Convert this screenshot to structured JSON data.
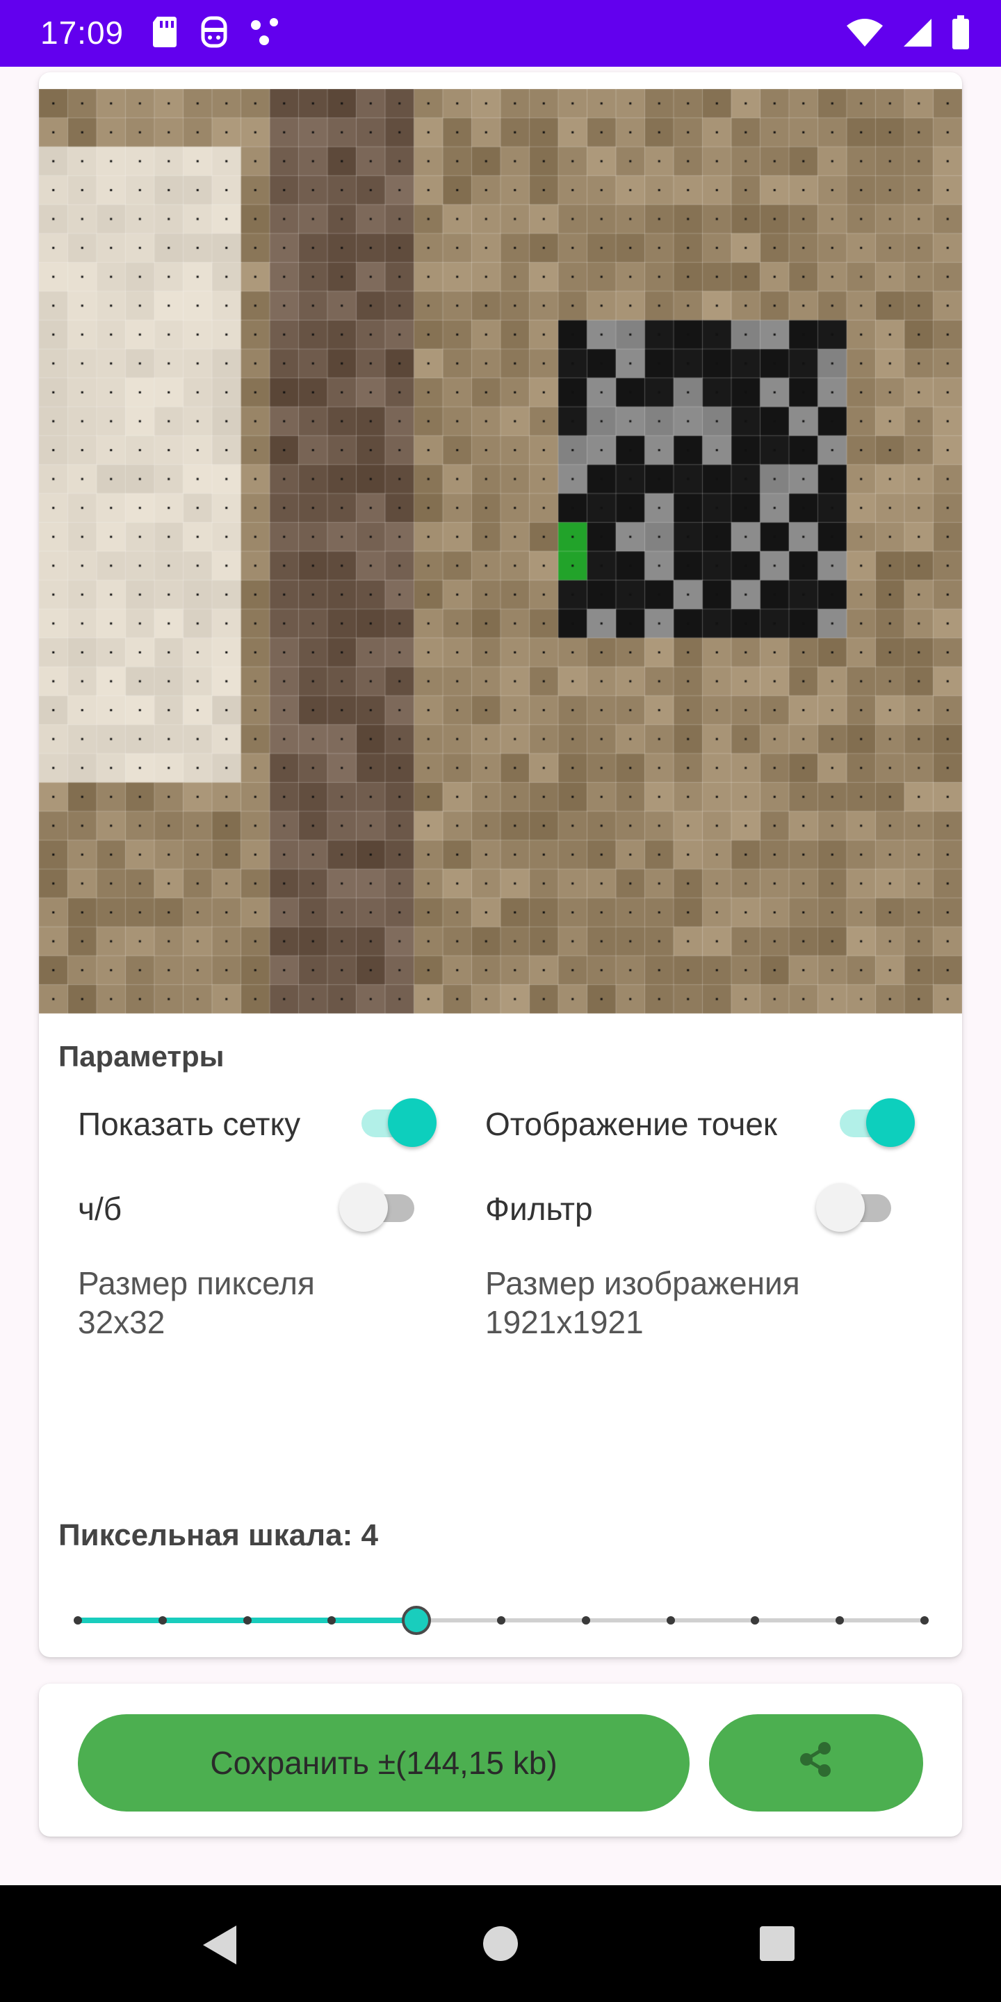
{
  "status_bar": {
    "time": "17:09",
    "left_icons": [
      "sd-card-icon",
      "robot-icon",
      "dots-icon"
    ],
    "right_icons": [
      "wifi-icon",
      "cell-signal-icon",
      "battery-icon"
    ],
    "background": "#6200ee"
  },
  "parameters": {
    "title": "Параметры",
    "show_grid": {
      "label": "Показать сетку",
      "on": true
    },
    "show_dots": {
      "label": "Отображение точек",
      "on": true
    },
    "bw": {
      "label": "ч/б",
      "on": false
    },
    "filter": {
      "label": "Фильтр",
      "on": false
    },
    "pixel_size": {
      "label": "Размер пикселя",
      "value": "32x32"
    },
    "image_size": {
      "label": "Размер изображения",
      "value": "1921x1921"
    }
  },
  "scale": {
    "label": "Пиксельная шкала: 4",
    "value": 4,
    "min": 0,
    "max": 10,
    "accent": "#19cdbd"
  },
  "actions": {
    "save_label": "Сохранить ±(144,15 kb)",
    "share_icon": "share-icon",
    "button_color": "#4caf50"
  },
  "nav": {
    "icons": [
      "back-icon",
      "home-icon",
      "recents-icon"
    ]
  }
}
